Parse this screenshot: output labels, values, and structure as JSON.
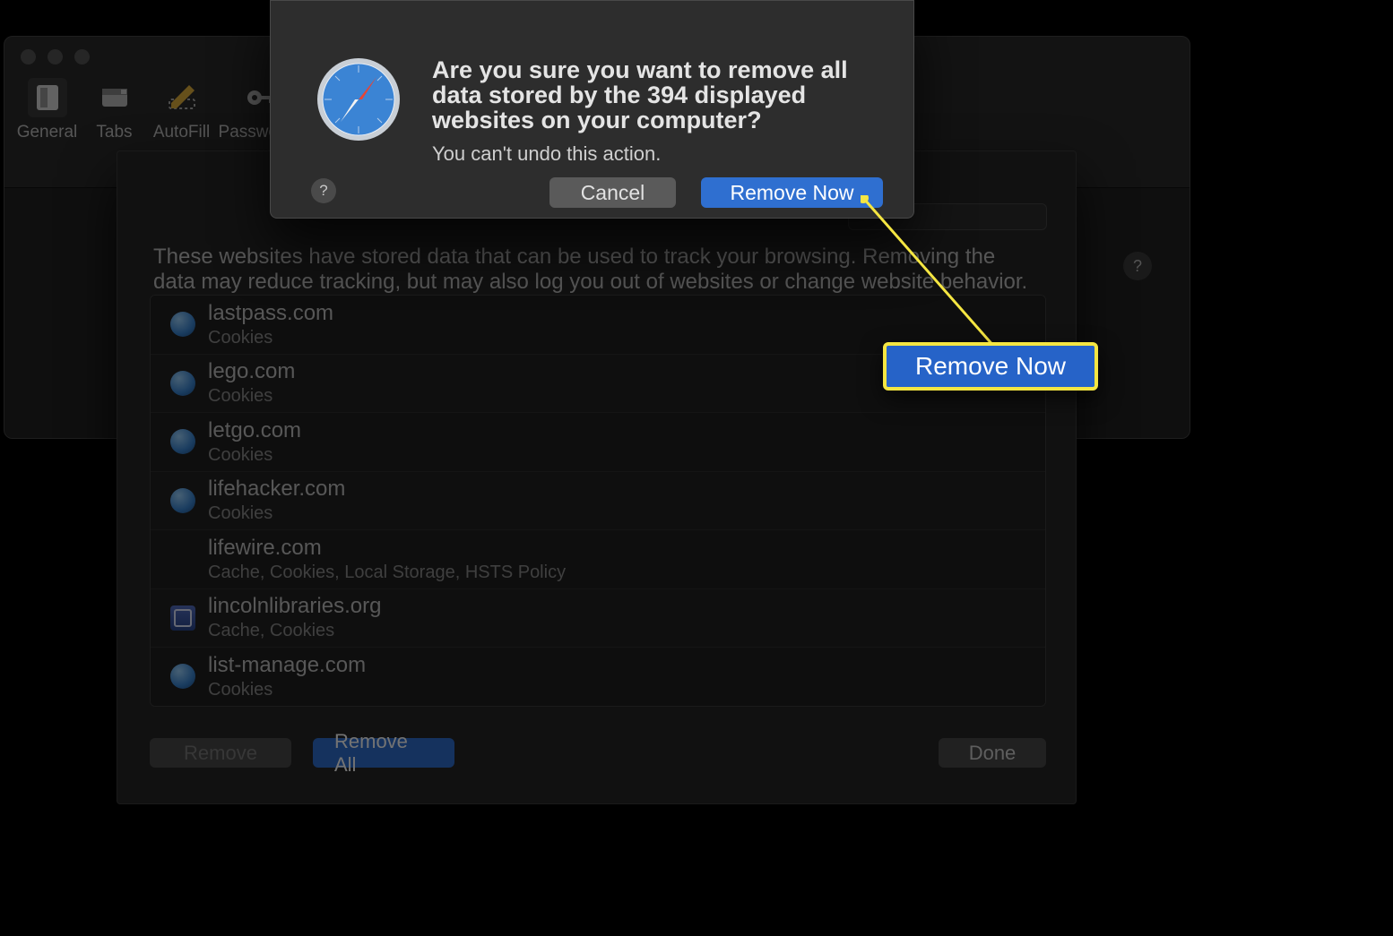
{
  "toolbar": {
    "items": [
      {
        "label": "General"
      },
      {
        "label": "Tabs"
      },
      {
        "label": "AutoFill"
      },
      {
        "label": "Passwords"
      }
    ]
  },
  "privacy_sheet": {
    "description": "These websites have stored data that can be used to track your browsing. Removing the data may reduce tracking, but may also log you out of websites or change website behavior.",
    "sites": [
      {
        "domain": "lastpass.com",
        "types": "Cookies",
        "icon": "globe"
      },
      {
        "domain": "lego.com",
        "types": "Cookies",
        "icon": "globe"
      },
      {
        "domain": "letgo.com",
        "types": "Cookies",
        "icon": "globe"
      },
      {
        "domain": "lifehacker.com",
        "types": "Cookies",
        "icon": "globe"
      },
      {
        "domain": "lifewire.com",
        "types": "Cache, Cookies, Local Storage, HSTS Policy",
        "icon": "none"
      },
      {
        "domain": "lincolnlibraries.org",
        "types": "Cache, Cookies",
        "icon": "square"
      },
      {
        "domain": "list-manage.com",
        "types": "Cookies",
        "icon": "globe"
      }
    ],
    "buttons": {
      "remove": "Remove",
      "remove_all": "Remove All",
      "done": "Done"
    }
  },
  "dialog": {
    "title": "Are you sure you want to remove all data stored by the 394 displayed websites on your computer?",
    "subtitle": "You can't undo this action.",
    "cancel": "Cancel",
    "confirm": "Remove Now",
    "help": "?"
  },
  "callout": {
    "label": "Remove Now"
  },
  "help_glyph": "?"
}
